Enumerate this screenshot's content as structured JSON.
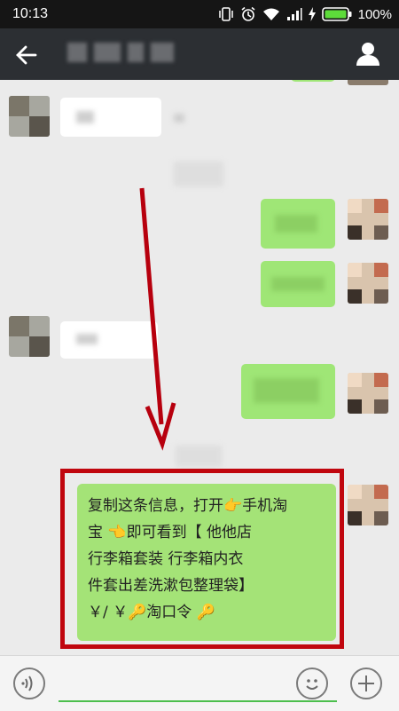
{
  "status_bar": {
    "time": "10:13",
    "battery": "100%"
  },
  "message": {
    "lines": [
      "复制这条信息，打开👉手机淘",
      "宝 👈即可看到【 他他店",
      "行李箱套装 行李箱内衣",
      "件套出差洗漱包整理袋】",
      "￥/        ￥🔑淘口令 🔑"
    ]
  },
  "input_bar": {
    "text_value": ""
  },
  "colors": {
    "status_bar": "#151515",
    "app_bar": "#2c2f33",
    "chat_background": "#ebebeb",
    "sent_bubble": "#a4e377",
    "highlight_box": "#c0060e",
    "arrow": "#b7000e",
    "input_underline": "#4cbf4d"
  }
}
